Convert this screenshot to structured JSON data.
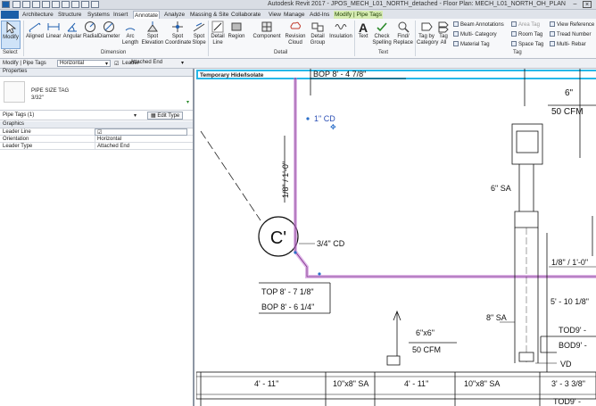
{
  "titlebar": {
    "app": "Autodesk Revit 2017 -",
    "doc": "JPOS_MECH_L01_NORTH_detached - Floor Plan: MECH_L01_NORTH_OH_PLAN"
  },
  "tabs": [
    "Architecture",
    "Structure",
    "Systems",
    "Insert",
    "Annotate",
    "Analyze",
    "Massing & Site",
    "Collaborate",
    "View",
    "Manage",
    "Add-Ins",
    "Modify | Pipe Tags"
  ],
  "active_tab": "Annotate",
  "ribbon": {
    "modify": "Modify",
    "dimension_tools": [
      "Aligned",
      "Linear",
      "Angular",
      "Radial",
      "Diameter",
      "Arc Length",
      "Spot Elevation",
      "Spot Coordinate",
      "Spot Slope"
    ],
    "detail_tools": [
      "Detail Line",
      "Region",
      "Component",
      "Revision Cloud",
      "Detail Group",
      "Insulation"
    ],
    "text_tools": [
      "Text",
      "Check Spelling",
      "Find/ Replace"
    ],
    "tag_tools_large": [
      "Tag by Category",
      "Tag All"
    ],
    "tag_tools_col1": [
      "Beam Annotations",
      "Multi- Category",
      "Material Tag"
    ],
    "tag_tools_col2": [
      "Area Tag",
      "Room Tag",
      "Space Tag"
    ],
    "tag_tools_col3": [
      "View Reference",
      "Tread Number",
      "Multi- Rebar"
    ],
    "panels": {
      "select": "Select",
      "dimension": "Dimension",
      "detail": "Detail",
      "text": "Text",
      "tag": "Tag"
    }
  },
  "options_bar": {
    "context": "Modify | Pipe Tags",
    "orientation": "Horizontal",
    "leader_label": "Leader",
    "leader_type": "Attached End"
  },
  "properties": {
    "title": "Properties",
    "type_family": "PIPE SIZE TAG",
    "type_name": "3/32\"",
    "selector": "Pipe Tags (1)",
    "edit_type": "Edit Type",
    "group": "Graphics",
    "rows": [
      {
        "key": "Leader Line",
        "value": "☑"
      },
      {
        "key": "Orientation",
        "value": "Horizontal"
      },
      {
        "key": "Leader Type",
        "value": "Attached End"
      }
    ]
  },
  "canvas": {
    "banner": "Temporary Hide/Isolate",
    "labels": {
      "bop_top": "BOP 8' - 4 7/8\"",
      "cd1": "1\" CD",
      "slope": "1/8\" / 1'-0\"",
      "callout": "C'",
      "cd34": "3/4\" CD",
      "top": "TOP 8' - 7 1/8\"",
      "bop": "BOP 8' - 6 1/4\"",
      "sixin": "6\"",
      "cfm50_top": "50 CFM",
      "sa6": "6\" SA",
      "slope_right": "1/8\" / 1'-0\"",
      "sa8": "8\" SA",
      "dim5_10": "5' - 10 1/8\"",
      "tod1": "TOD9' -",
      "bod1": "BOD9' -",
      "vd": "VD",
      "duct6x6": "6\"x6\"",
      "cfm50_mid": "50 CFM",
      "dim4_11a": "4' - 11\"",
      "duct10x8a": "10\"x8\" SA",
      "dim4_11b": "4' - 11\"",
      "duct10x8b": "10\"x8\" SA",
      "dim3_3": "3' - 3 3/8\"",
      "tod2": "TOD9' -"
    }
  }
}
